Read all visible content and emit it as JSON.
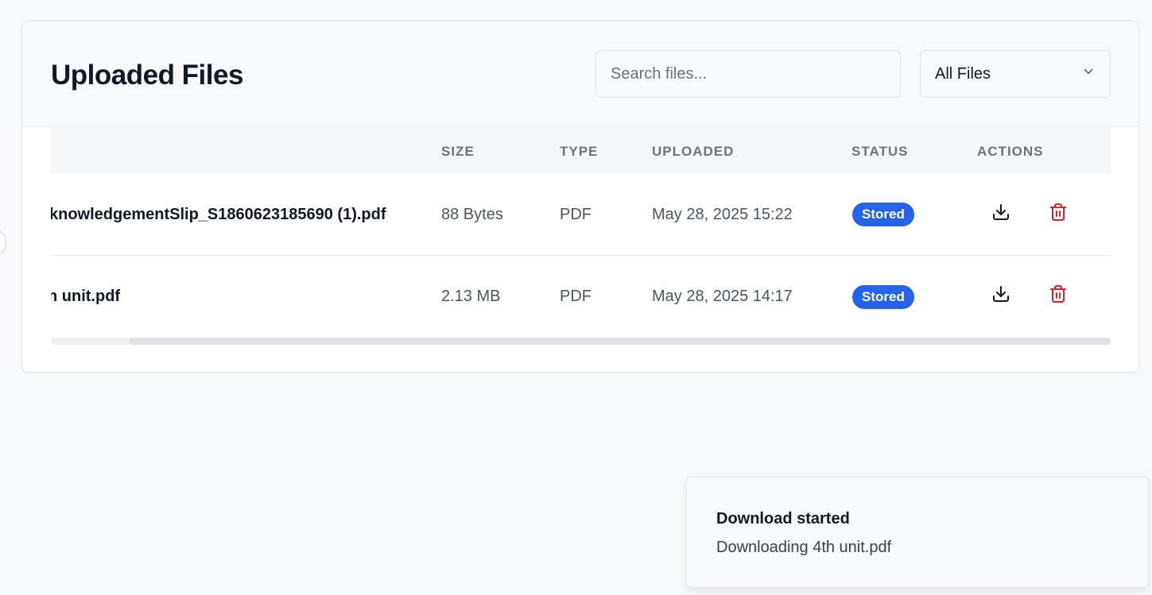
{
  "header": {
    "title": "Uploaded Files",
    "search_placeholder": "Search files...",
    "filter_value": "All Files"
  },
  "table": {
    "columns": [
      "SIZE",
      "TYPE",
      "UPLOADED",
      "STATUS",
      "ACTIONS"
    ],
    "rows": [
      {
        "name": "knowledgementSlip_S1860623185690 (1).pdf",
        "size": "88 Bytes",
        "type": "PDF",
        "uploaded": "May 28, 2025 15:22",
        "status": "Stored"
      },
      {
        "name": "h unit.pdf",
        "size": "2.13 MB",
        "type": "PDF",
        "uploaded": "May 28, 2025 14:17",
        "status": "Stored"
      }
    ]
  },
  "toast": {
    "title": "Download started",
    "message": "Downloading 4th unit.pdf"
  },
  "icons": {
    "download": "download-icon",
    "delete": "trash-icon",
    "dropdown": "chevron-down-icon"
  },
  "colors": {
    "status_badge": "#2563eb",
    "delete_icon": "#dc2626"
  }
}
